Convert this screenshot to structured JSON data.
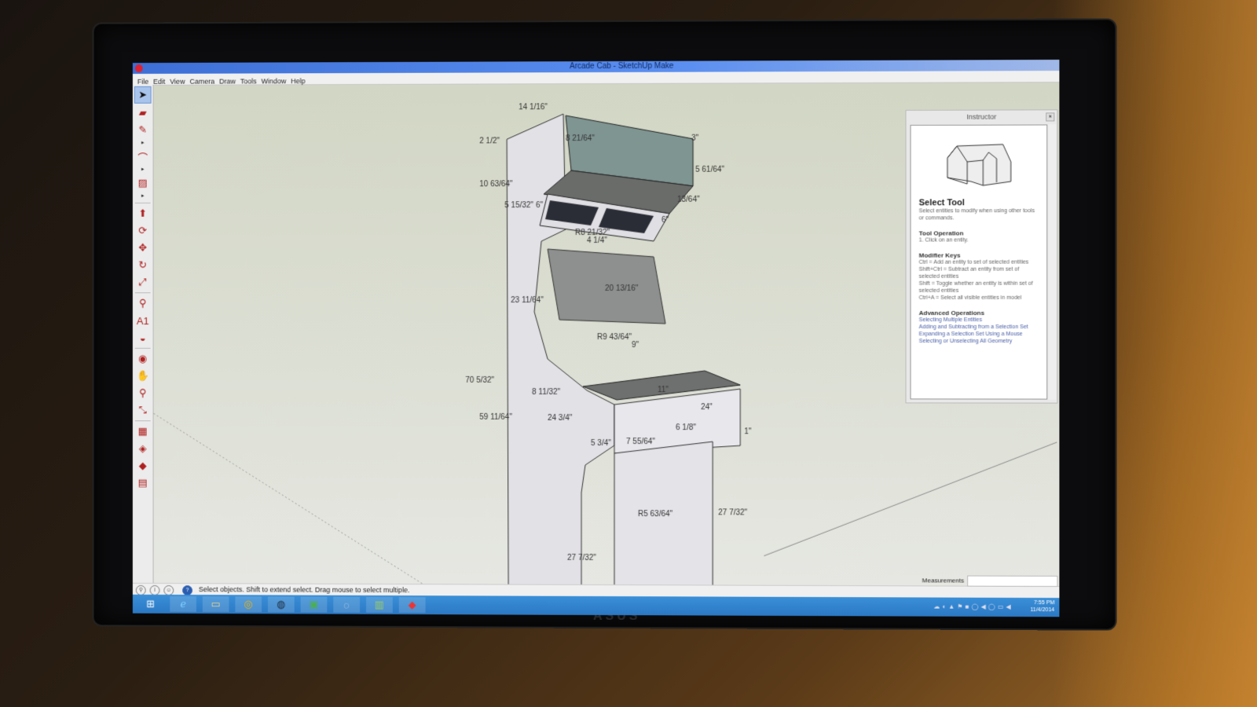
{
  "window": {
    "title": "Arcade Cab - SketchUp Make"
  },
  "menu": [
    "File",
    "Edit",
    "View",
    "Camera",
    "Draw",
    "Tools",
    "Window",
    "Help"
  ],
  "toolbar": {
    "tools": [
      {
        "name": "select-tool",
        "glyph": "➤",
        "active": true
      },
      {
        "name": "eraser-tool",
        "glyph": "▰"
      },
      {
        "name": "pencil-tool",
        "glyph": "✎",
        "flyout": true
      },
      {
        "name": "arc-tool",
        "glyph": "⌒",
        "flyout": true
      },
      {
        "name": "rectangle-tool",
        "glyph": "▨",
        "flyout": true
      },
      {
        "sep": true
      },
      {
        "name": "push-pull-tool",
        "glyph": "⬆"
      },
      {
        "name": "follow-me-tool",
        "glyph": "⟳"
      },
      {
        "name": "move-tool",
        "glyph": "✥"
      },
      {
        "name": "rotate-tool",
        "glyph": "↻"
      },
      {
        "name": "scale-tool",
        "glyph": "⤢"
      },
      {
        "sep": true
      },
      {
        "name": "tape-measure-tool",
        "glyph": "⚲"
      },
      {
        "name": "text-tool",
        "glyph": "A1"
      },
      {
        "name": "paint-bucket-tool",
        "glyph": "◒"
      },
      {
        "sep": true
      },
      {
        "name": "orbit-tool",
        "glyph": "◉"
      },
      {
        "name": "pan-tool",
        "glyph": "✋"
      },
      {
        "name": "zoom-tool",
        "glyph": "⚲"
      },
      {
        "name": "zoom-extents-tool",
        "glyph": "⤡"
      },
      {
        "sep": true
      },
      {
        "name": "3d-warehouse-tool",
        "glyph": "▦"
      },
      {
        "name": "share-model-tool",
        "glyph": "◈"
      },
      {
        "name": "extension-warehouse-tool",
        "glyph": "◆"
      },
      {
        "name": "send-to-layout-tool",
        "glyph": "▤"
      }
    ]
  },
  "model": {
    "dimensions": {
      "top_depth": "14 1/16\"",
      "top_offset": "2 1/2\"",
      "marquee_height": "8 21/64\"",
      "marquee_lip": "3\"",
      "marquee_panel": "5 61/64\"",
      "upper_side": "10 63/64\"",
      "speaker_depth": "5 15/32\"",
      "speaker_width": "6\"",
      "speaker_offset": "13/64\"",
      "speaker_bottom": "6\"",
      "upper_radius": "R8 21/32\"",
      "screen_gap": "4 1/4\"",
      "screen_diag": "20 13/16\"",
      "screen_side": "23 11/64\"",
      "lower_radius": "R9 43/64\"",
      "screen_to_panel": "9\"",
      "overall_height": "70 5/32\"",
      "panel_depth": "8 11/32\"",
      "panel_width": "11\"",
      "panel_length": "24\"",
      "floor_to_panel": "59 11/64\"",
      "base_depth": "24 3/4\"",
      "front_height": "6 1/8\"",
      "kick_depth": "5 3/4\"",
      "front_panel": "7 55/64\"",
      "kick_radius": "R5 63/64\"",
      "leg_height_right": "27 7/32\"",
      "leg_height_left": "27 7/32\"",
      "lip": "1\""
    }
  },
  "instructor": {
    "panel_title": "Instructor",
    "tool_name": "Select Tool",
    "tool_desc": "Select entities to modify when using other tools or commands.",
    "operation_heading": "Tool Operation",
    "operation_steps": [
      "1.   Click on an entity."
    ],
    "modifier_heading": "Modifier Keys",
    "modifier_keys": [
      "Ctrl = Add an entity to set of selected entities",
      "Shift+Ctrl = Subtract an entity from set of selected entities",
      "Shift = Toggle whether an entity is within set of selected entities",
      "Ctrl+A = Select all visible entities in model"
    ],
    "advanced_heading": "Advanced Operations",
    "advanced_links": [
      "Selecting Multiple Entities",
      "Adding and Subtracting from a Selection Set",
      "Expanding a Selection Set Using a Mouse",
      "Selecting or Unselecting All Geometry"
    ]
  },
  "status": {
    "message": "Select objects. Shift to extend select. Drag mouse to select multiple.",
    "measurements_label": "Measurements",
    "measurements_value": ""
  },
  "taskbar": {
    "apps": [
      {
        "name": "start-button",
        "glyph": "⊞"
      },
      {
        "name": "internet-explorer",
        "glyph": "ℯ"
      },
      {
        "name": "file-explorer",
        "glyph": "▭"
      },
      {
        "name": "chrome",
        "glyph": "◎"
      },
      {
        "name": "steam",
        "glyph": "◍"
      },
      {
        "name": "windows-store",
        "glyph": "▣"
      },
      {
        "name": "app-7",
        "glyph": "◌"
      },
      {
        "name": "app-8",
        "glyph": "▥"
      },
      {
        "name": "sketchup",
        "glyph": "◆"
      }
    ],
    "clock_time": "7:55 PM",
    "clock_date": "11/4/2014"
  },
  "monitor_brand": "ASUS"
}
